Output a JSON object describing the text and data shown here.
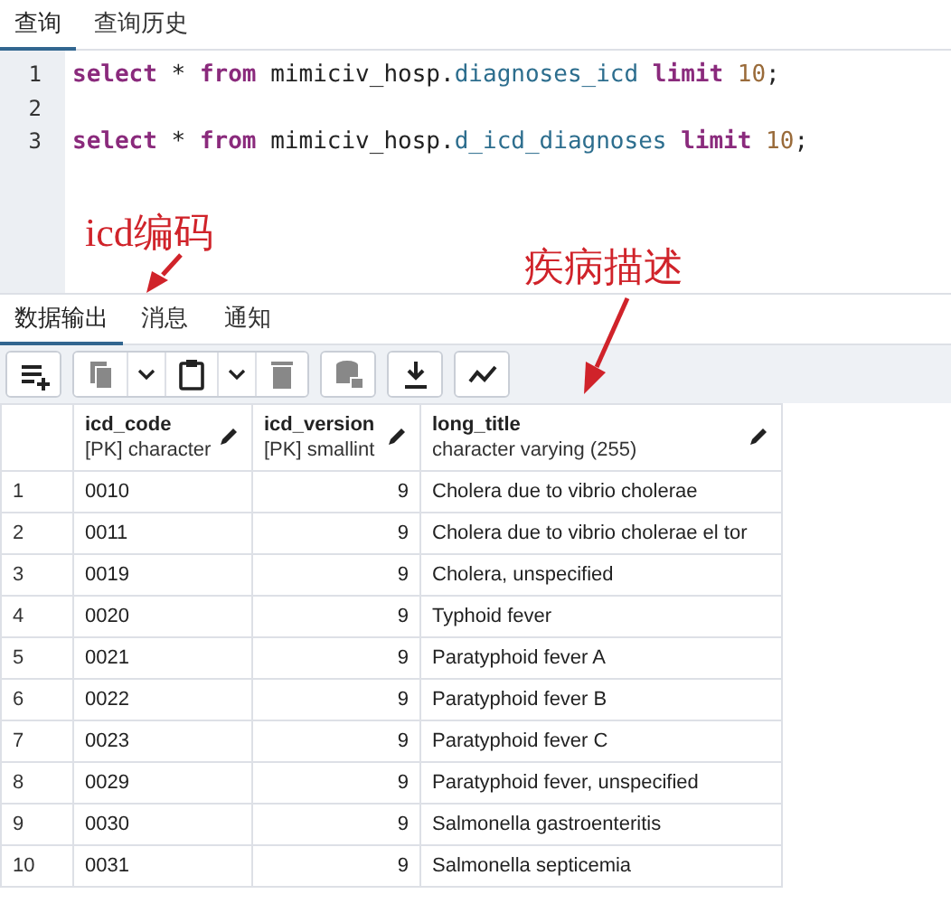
{
  "query_tabs": [
    {
      "label": "查询",
      "selected": true
    },
    {
      "label": "查询历史",
      "selected": false
    }
  ],
  "editor": {
    "lines": [
      {
        "number": "1",
        "tokens": [
          {
            "kind": "keyword",
            "text": "select"
          },
          {
            "kind": "plain",
            "text": " * "
          },
          {
            "kind": "keyword",
            "text": "from"
          },
          {
            "kind": "plain",
            "text": " mimiciv_hosp."
          },
          {
            "kind": "name",
            "text": "diagnoses_icd "
          },
          {
            "kind": "keyword",
            "text": "limit "
          },
          {
            "kind": "number",
            "text": "10"
          },
          {
            "kind": "plain",
            "text": ";"
          }
        ]
      },
      {
        "number": "2"
      },
      {
        "number": "3",
        "tokens": [
          {
            "kind": "keyword",
            "text": "select"
          },
          {
            "kind": "plain",
            "text": " * "
          },
          {
            "kind": "keyword",
            "text": "from"
          },
          {
            "kind": "plain",
            "text": " mimiciv_hosp."
          },
          {
            "kind": "name",
            "text": "d_icd_diagnoses "
          },
          {
            "kind": "keyword",
            "text": "limit "
          },
          {
            "kind": "number",
            "text": "10"
          },
          {
            "kind": "plain",
            "text": ";"
          }
        ]
      }
    ]
  },
  "output_tabs": [
    {
      "label": "数据输出",
      "selected": true
    },
    {
      "label": "消息",
      "selected": false
    },
    {
      "label": "通知",
      "selected": false
    }
  ],
  "toolbar": [
    [
      {
        "kind": "add-row",
        "disabled": false
      }
    ],
    [
      {
        "kind": "copy",
        "disabled": true
      },
      {
        "kind": "caret",
        "disabled": false
      },
      {
        "kind": "paste",
        "disabled": false
      },
      {
        "kind": "caret",
        "disabled": false
      },
      {
        "kind": "delete",
        "disabled": true
      }
    ],
    [
      {
        "kind": "save-data",
        "disabled": true
      }
    ],
    [
      {
        "kind": "download",
        "disabled": false
      }
    ],
    [
      {
        "kind": "graph",
        "disabled": false
      }
    ]
  ],
  "table": {
    "columns": [
      {
        "name": "icd_code",
        "type": "[PK] character"
      },
      {
        "name": "icd_version",
        "type": "[PK] smallint"
      },
      {
        "name": "long_title",
        "type": "character varying (255)"
      }
    ],
    "rows": [
      {
        "number": "1",
        "cells": [
          "0010",
          "9",
          "Cholera due to vibrio cholerae"
        ]
      },
      {
        "number": "2",
        "cells": [
          "0011",
          "9",
          "Cholera due to vibrio cholerae el tor"
        ]
      },
      {
        "number": "3",
        "cells": [
          "0019",
          "9",
          "Cholera, unspecified"
        ]
      },
      {
        "number": "4",
        "cells": [
          "0020",
          "9",
          "Typhoid fever"
        ]
      },
      {
        "number": "5",
        "cells": [
          "0021",
          "9",
          "Paratyphoid fever A"
        ]
      },
      {
        "number": "6",
        "cells": [
          "0022",
          "9",
          "Paratyphoid fever B"
        ]
      },
      {
        "number": "7",
        "cells": [
          "0023",
          "9",
          "Paratyphoid fever C"
        ]
      },
      {
        "number": "8",
        "cells": [
          "0029",
          "9",
          "Paratyphoid fever, unspecified"
        ]
      },
      {
        "number": "9",
        "cells": [
          "0030",
          "9",
          "Salmonella gastroenteritis"
        ]
      },
      {
        "number": "10",
        "cells": [
          "0031",
          "9",
          "Salmonella septicemia"
        ]
      }
    ]
  },
  "annotations": [
    {
      "text": "icd编码"
    },
    {
      "text": "疾病描述"
    }
  ]
}
